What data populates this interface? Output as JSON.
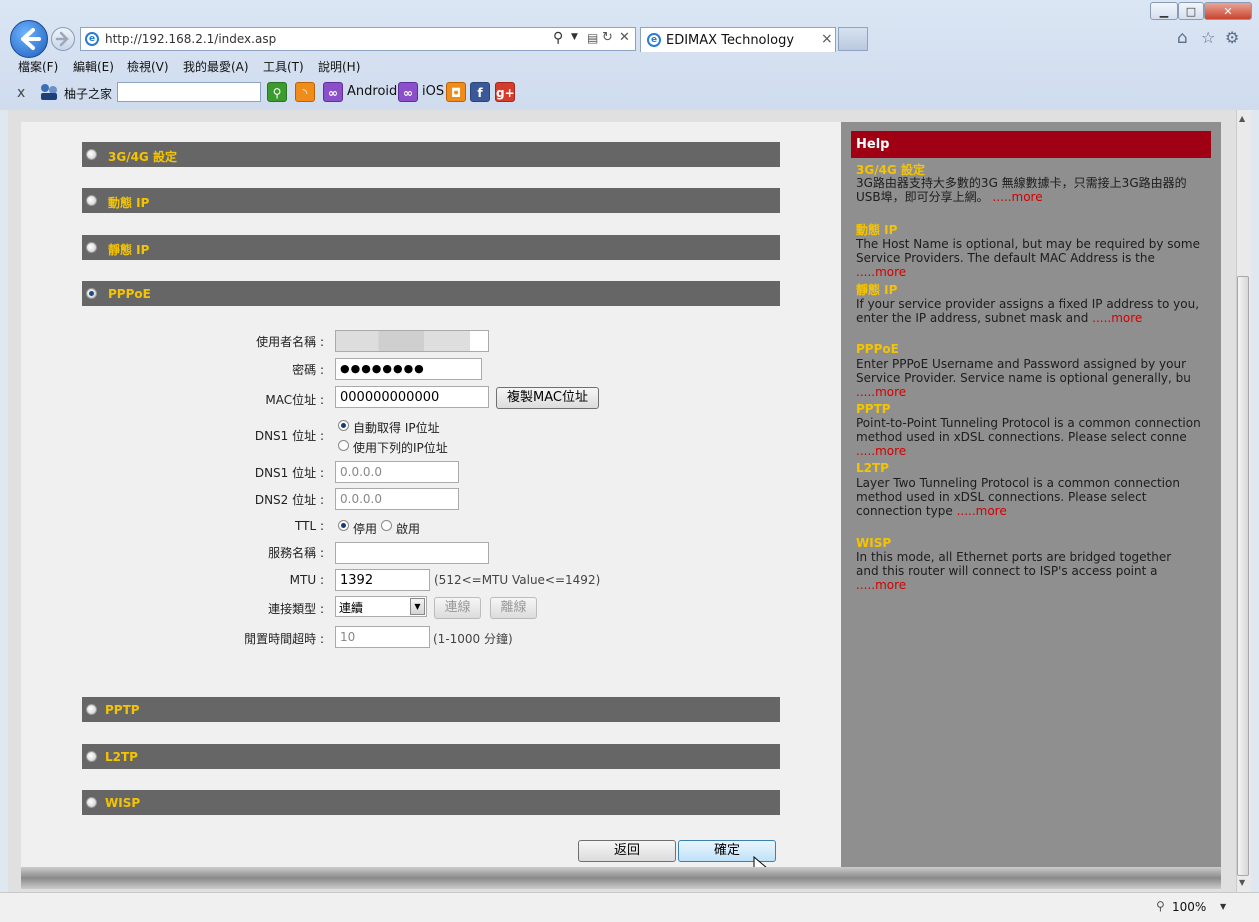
{
  "window": {
    "minimize_label": "▁",
    "maximize_label": "□",
    "close_label": "✕"
  },
  "address_bar": {
    "url": "http://192.168.2.1/index.asp"
  },
  "tab": {
    "title": "EDIMAX Technology",
    "close_label": "×"
  },
  "menu": [
    "檔案(F)",
    "編輯(E)",
    "檢視(V)",
    "我的最愛(A)",
    "工具(T)",
    "說明(H)"
  ],
  "favorites_bar": {
    "close_label": "x",
    "site_name": "柚子之家",
    "search_value": "",
    "android_label": "Android",
    "ios_label": "iOS"
  },
  "sections": {
    "s3g": "3G/4G 設定",
    "dynamic": "動態 IP",
    "static": "靜態 IP",
    "pppoe": "PPPoE",
    "pptp": "PPTP",
    "l2tp": "L2TP",
    "wisp": "WISP",
    "selected": "PPPoE"
  },
  "form": {
    "username_label": "使用者名稱 :",
    "username_value": "",
    "password_label": "密碼 :",
    "password_value": "●●●●●●●●",
    "mac_label": "MAC位址 :",
    "mac_value": "000000000000",
    "clone_mac_button": "複製MAC位址",
    "dns_mode_label": "DNS1 位址 :",
    "dns_auto_label": "自動取得 IP位址",
    "dns_manual_label": "使用下列的IP位址",
    "dns1_label": "DNS1 位址 :",
    "dns1_value": "0.0.0.0",
    "dns2_label": "DNS2 位址 :",
    "dns2_value": "0.0.0.0",
    "ttl_label": "TTL :",
    "ttl_disable": "停用",
    "ttl_enable": "啟用",
    "service_label": "服務名稱 :",
    "service_value": "",
    "mtu_label": "MTU :",
    "mtu_value": "1392",
    "mtu_hint": "(512<=MTU Value<=1492)",
    "conn_type_label": "連接類型 :",
    "conn_type_value": "連續",
    "connect_button": "連線",
    "disconnect_button": "離線",
    "idle_label": "閒置時間超時 :",
    "idle_value": "10",
    "idle_hint": "(1-1000 分鐘)"
  },
  "buttons": {
    "back": "返回",
    "ok": "確定"
  },
  "help": {
    "title": "Help",
    "more": ".....more",
    "items": [
      {
        "head": "3G/4G 設定",
        "body": "3G路由器支持大多數的3G 無線數據卡，只需接上3G路由器的USB埠，即可分享上網。 "
      },
      {
        "head": "動態 IP",
        "body": "The Host Name is optional, but may be required by some Service Providers. The default MAC Address is the "
      },
      {
        "head": "靜態 IP",
        "body": "If your service provider assigns a fixed IP address to you, enter the IP address, subnet mask and "
      },
      {
        "head": "PPPoE",
        "body": "Enter PPPoE Username and Password assigned by your Service Provider. Service name is optional generally, bu "
      },
      {
        "head": "PPTP",
        "body": "Point-to-Point Tunneling Protocol is a common connection method used in xDSL connections. Please select conne "
      },
      {
        "head": "L2TP",
        "body": "Layer Two Tunneling Protocol is a common connection method used in xDSL connections. Please select connection type "
      },
      {
        "head": "WISP",
        "body": "In this mode, all Ethernet ports are bridged together and this router will connect to ISP's access point a "
      }
    ]
  },
  "status_bar": {
    "zoom": "100%"
  }
}
